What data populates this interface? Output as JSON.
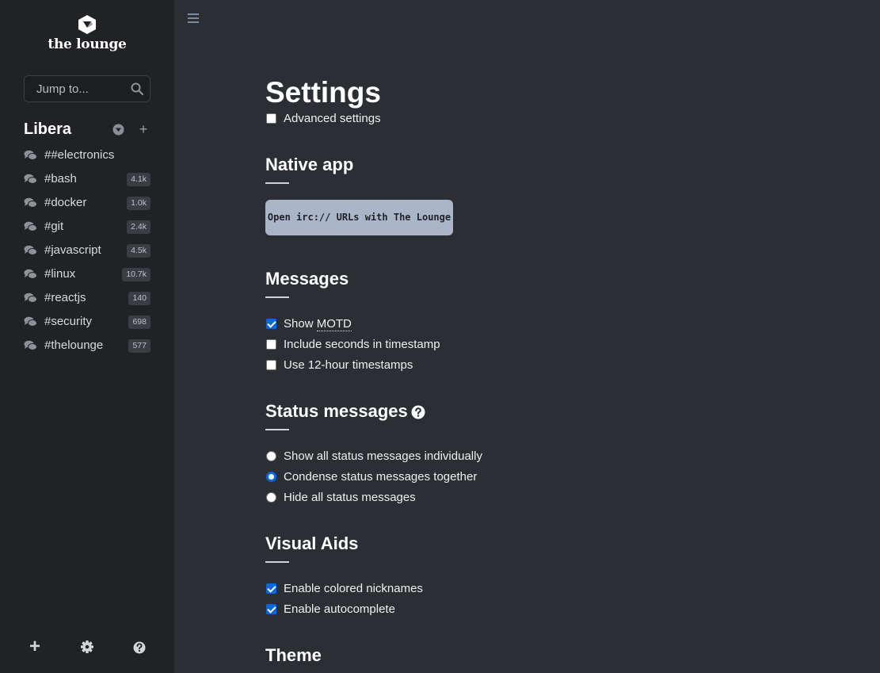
{
  "app": {
    "logo_text": "the lounge"
  },
  "sidebar": {
    "search_placeholder": "Jump to...",
    "network": {
      "name": "Libera",
      "add_symbol": "+"
    },
    "channels": [
      {
        "name": "##electronics",
        "badge": ""
      },
      {
        "name": "#bash",
        "badge": "4.1k"
      },
      {
        "name": "#docker",
        "badge": "1.0k"
      },
      {
        "name": "#git",
        "badge": "2.4k"
      },
      {
        "name": "#javascript",
        "badge": "4.5k"
      },
      {
        "name": "#linux",
        "badge": "10.7k"
      },
      {
        "name": "#reactjs",
        "badge": "140"
      },
      {
        "name": "#security",
        "badge": "698"
      },
      {
        "name": "#thelounge",
        "badge": "577"
      }
    ],
    "footer": {
      "add_symbol": "+",
      "settings_icon": "gear-icon",
      "help_icon": "help-icon"
    }
  },
  "settings": {
    "title": "Settings",
    "advanced": {
      "label": "Advanced settings",
      "checked": false
    },
    "native_app": {
      "heading": "Native app",
      "button": "Open irc:// URLs with The Lounge"
    },
    "messages": {
      "heading": "Messages",
      "show_prefix": "Show ",
      "show_abbr": "MOTD",
      "show_motd_checked": true,
      "seconds": {
        "label": "Include seconds in timestamp",
        "checked": false
      },
      "twelve_hour": {
        "label": "Use 12-hour timestamps",
        "checked": false
      }
    },
    "status_messages": {
      "heading": "Status messages",
      "options": [
        {
          "label": "Show all status messages individually",
          "selected": false
        },
        {
          "label": "Condense status messages together",
          "selected": true
        },
        {
          "label": "Hide all status messages",
          "selected": false
        }
      ]
    },
    "visual_aids": {
      "heading": "Visual Aids",
      "colored": {
        "label": "Enable colored nicknames",
        "checked": true
      },
      "autocomplete": {
        "label": "Enable autocomplete",
        "checked": true
      }
    },
    "theme": {
      "heading": "Theme"
    }
  },
  "colors": {
    "sidebar_bg": "#202226",
    "main_bg": "#2b2e33",
    "accent": "#0b68dc",
    "native_button_bg": "#aab6c8"
  }
}
